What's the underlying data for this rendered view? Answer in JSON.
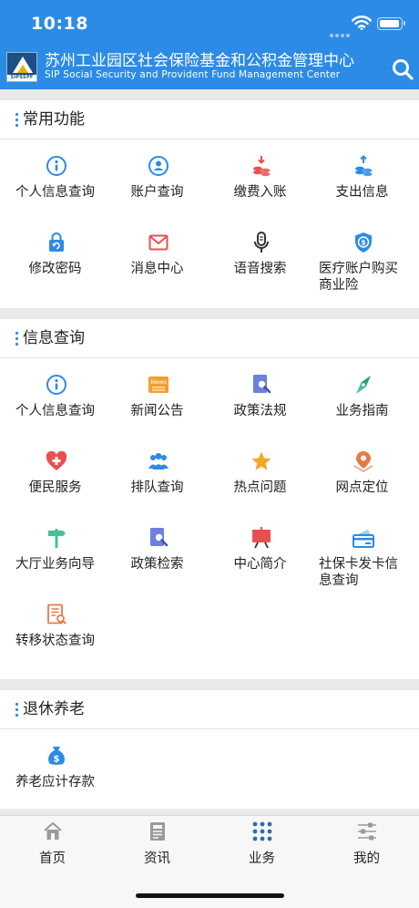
{
  "status_bar": {
    "time": "10:18"
  },
  "header": {
    "logo_text": "SIPSSPF",
    "title_cn": "苏州工业园区社会保险基金和公积金管理中心",
    "title_en": "SIP Social Security and Provident Fund Management Center"
  },
  "sections": {
    "common": {
      "title": "常用功能",
      "items": [
        {
          "label": "个人信息查询",
          "icon": "info-icon"
        },
        {
          "label": "账户查询",
          "icon": "account-user-icon"
        },
        {
          "label": "缴费入账",
          "icon": "coin-deposit-icon"
        },
        {
          "label": "支出信息",
          "icon": "coin-withdraw-icon"
        },
        {
          "label": "修改密码",
          "icon": "lock-refresh-icon"
        },
        {
          "label": "消息中心",
          "icon": "envelope-icon"
        },
        {
          "label": "语音搜索",
          "icon": "microphone-icon"
        },
        {
          "label": "医疗账户购买商业险",
          "icon": "shield-dollar-icon"
        }
      ]
    },
    "info": {
      "title": "信息查询",
      "items": [
        {
          "label": "个人信息查询",
          "icon": "info-icon"
        },
        {
          "label": "新闻公告",
          "icon": "news-icon",
          "badge": "News"
        },
        {
          "label": "政策法规",
          "icon": "document-search-icon"
        },
        {
          "label": "业务指南",
          "icon": "compass-icon"
        },
        {
          "label": "便民服务",
          "icon": "heart-plus-icon"
        },
        {
          "label": "排队查询",
          "icon": "people-queue-icon"
        },
        {
          "label": "热点问题",
          "icon": "star-icon"
        },
        {
          "label": "网点定位",
          "icon": "location-pin-icon"
        },
        {
          "label": "大厅业务向导",
          "icon": "signpost-icon"
        },
        {
          "label": "政策检索",
          "icon": "document-search-icon"
        },
        {
          "label": "中心简介",
          "icon": "presentation-board-icon"
        },
        {
          "label": "社保卡发卡信息查询",
          "icon": "card-icon"
        },
        {
          "label": "转移状态查询",
          "icon": "document-magnifier-icon"
        }
      ]
    },
    "retire": {
      "title": "退休养老",
      "items": [
        {
          "label": "养老应计存款",
          "icon": "money-bag-icon"
        }
      ]
    }
  },
  "tabbar": {
    "tabs": [
      {
        "label": "首页",
        "icon": "home-icon"
      },
      {
        "label": "资讯",
        "icon": "news-list-icon"
      },
      {
        "label": "业务",
        "icon": "grid-dots-icon",
        "active": true
      },
      {
        "label": "我的",
        "icon": "settings-sliders-icon"
      }
    ]
  },
  "colors": {
    "header_blue": "#2c8be6",
    "accent_blue": "#2c8be6",
    "icon_red": "#e8504f",
    "icon_orange": "#f0a030"
  }
}
